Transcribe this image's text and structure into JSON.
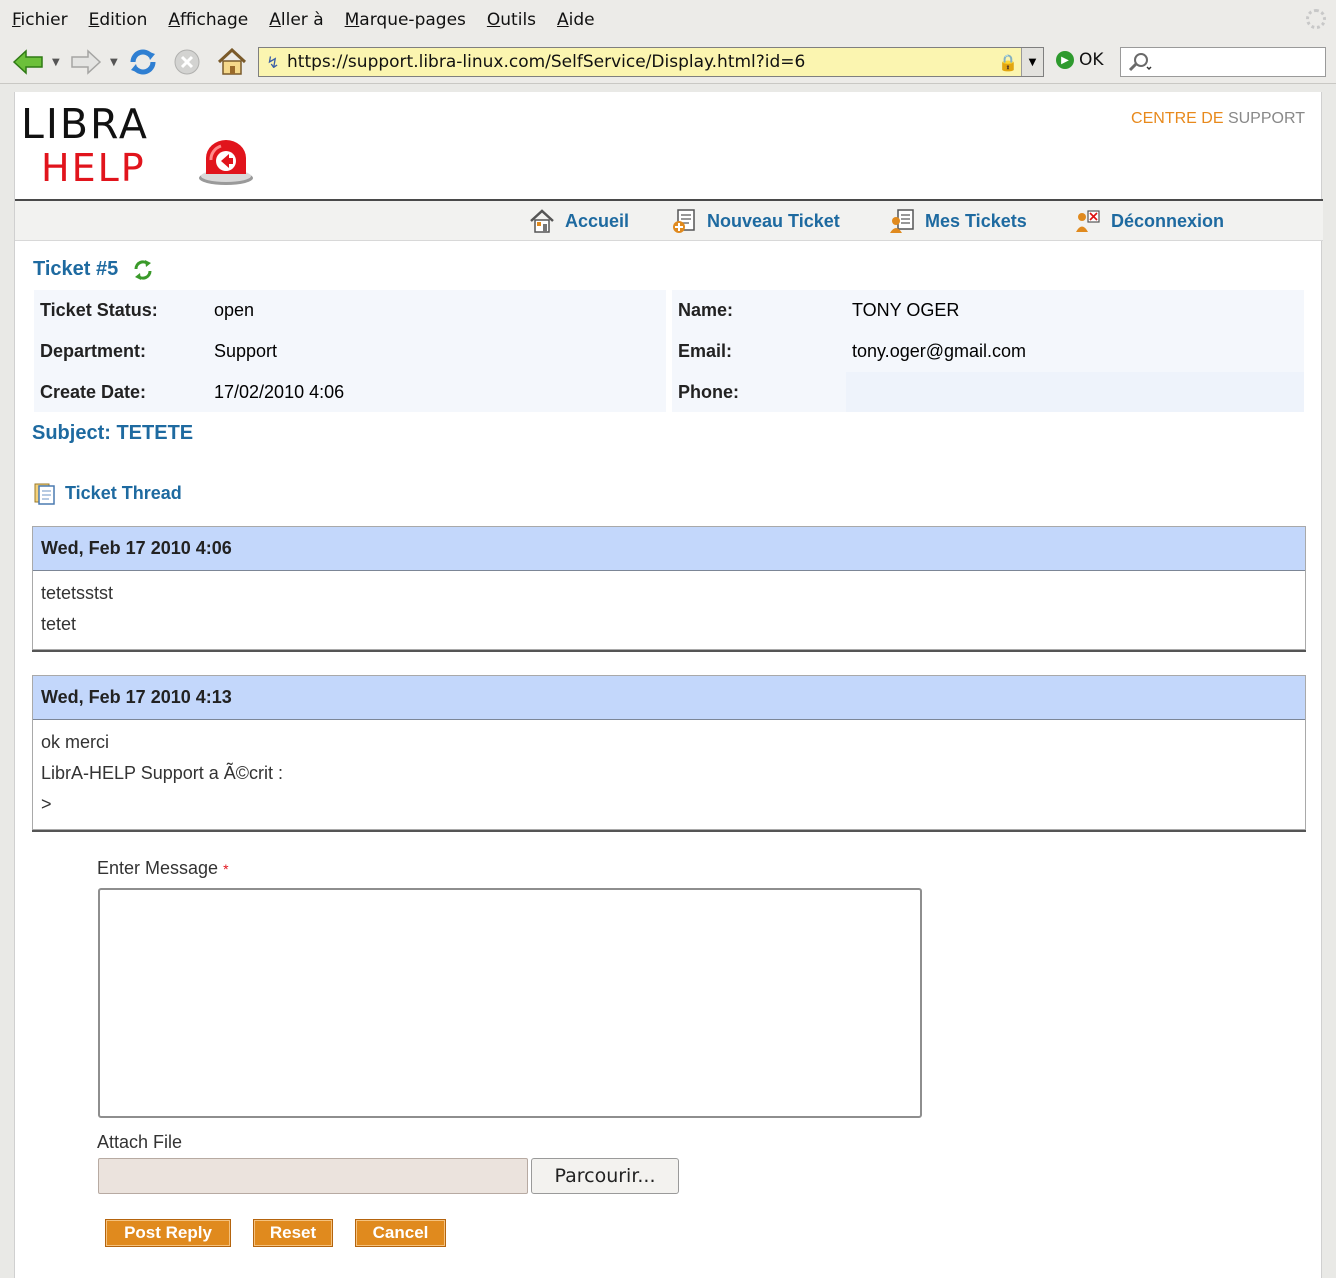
{
  "browser": {
    "menu": [
      {
        "first": "F",
        "rest": "ichier"
      },
      {
        "first": "E",
        "rest": "dition"
      },
      {
        "first": "A",
        "rest": "ffichage"
      },
      {
        "first": "A",
        "rest": "ller à"
      },
      {
        "first": "M",
        "rest": "arque-pages"
      },
      {
        "first": "O",
        "rest": "utils"
      },
      {
        "first": "A",
        "rest": "ide"
      }
    ],
    "url": "https://support.libra-linux.com/SelfService/Display.html?id=6",
    "go_label": "OK",
    "icons": [
      "back-icon",
      "forward-icon",
      "reload-icon",
      "stop-icon",
      "home-icon",
      "lock-icon",
      "search-icon"
    ]
  },
  "header": {
    "logo_line1": "LIBRA",
    "logo_line2": "HELP",
    "centre_part1": "CENTRE DE",
    "centre_part2": "SUPPORT"
  },
  "nav": [
    {
      "label": "Accueil",
      "icon": "home-icon"
    },
    {
      "label": "Nouveau Ticket",
      "icon": "new-ticket-icon"
    },
    {
      "label": "Mes Tickets",
      "icon": "my-tickets-icon"
    },
    {
      "label": "Déconnexion",
      "icon": "logout-icon"
    }
  ],
  "ticket": {
    "title": "Ticket #5",
    "status_label": "Ticket Status:",
    "status": "open",
    "department_label": "Department:",
    "department": "Support",
    "create_date_label": "Create Date:",
    "create_date": "17/02/2010 4:06",
    "name_label": "Name:",
    "name": "TONY OGER",
    "email_label": "Email:",
    "email": "tony.oger@gmail.com",
    "phone_label": "Phone:",
    "phone": "",
    "subject": "Subject: TETETE"
  },
  "thread": {
    "title": "Ticket Thread",
    "messages": [
      {
        "date": "Wed, Feb 17 2010 4:06",
        "lines": [
          "tetetsstst",
          "tetet"
        ]
      },
      {
        "date": "Wed, Feb 17 2010 4:13",
        "lines": [
          "ok merci",
          "LibrA-HELP Support a Ã©crit :",
          ">"
        ]
      }
    ]
  },
  "form": {
    "message_label": "Enter Message",
    "required_mark": "*",
    "attach_label": "Attach File",
    "browse_label": "Parcourir...",
    "post_label": "Post Reply",
    "reset_label": "Reset",
    "cancel_label": "Cancel"
  },
  "colors": {
    "link_blue": "#1e6aa0",
    "thread_header": "#c3d7fb",
    "button_orange": "#e08a1e",
    "logo_red": "#e1141c",
    "centre_orange": "#e8891b"
  }
}
